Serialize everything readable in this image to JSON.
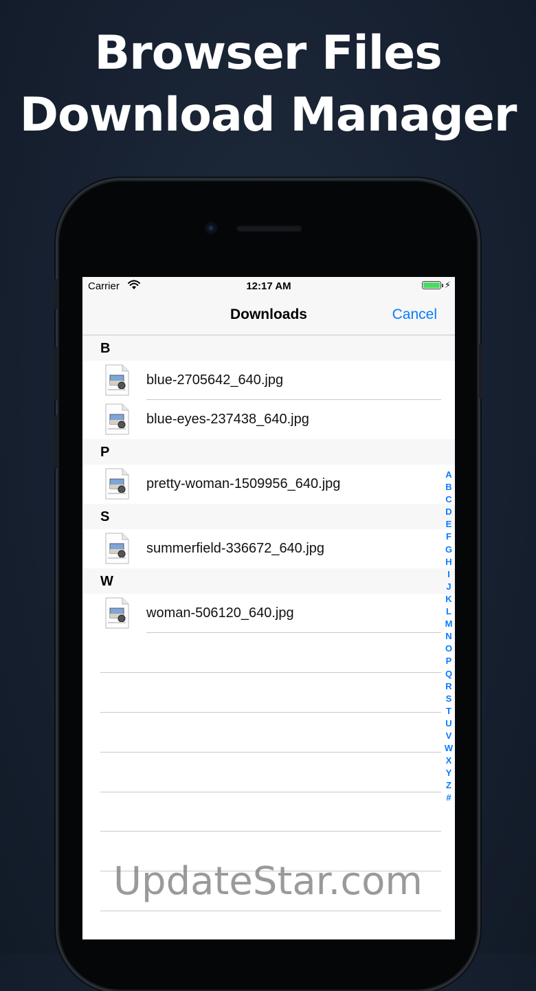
{
  "headline": {
    "line1": "Browser Files",
    "line2": "Download Manager"
  },
  "statusbar": {
    "carrier": "Carrier",
    "time": "12:17 AM",
    "bolt": "⚡",
    "battery_level": 1.0
  },
  "navbar": {
    "title": "Downloads",
    "cancel_label": "Cancel"
  },
  "sections": [
    {
      "letter": "B",
      "files": [
        "blue-2705642_640.jpg",
        "blue-eyes-237438_640.jpg"
      ]
    },
    {
      "letter": "P",
      "files": [
        "pretty-woman-1509956_640.jpg"
      ]
    },
    {
      "letter": "S",
      "files": [
        "summerfield-336672_640.jpg"
      ]
    },
    {
      "letter": "W",
      "files": [
        "woman-506120_640.jpg"
      ]
    }
  ],
  "index_letters": [
    "A",
    "B",
    "C",
    "D",
    "E",
    "F",
    "G",
    "H",
    "I",
    "J",
    "K",
    "L",
    "M",
    "N",
    "O",
    "P",
    "Q",
    "R",
    "S",
    "T",
    "U",
    "V",
    "W",
    "X",
    "Y",
    "Z",
    "#"
  ],
  "watermark": "UpdateStar.com",
  "colors": {
    "accent": "#0a7aff",
    "battery": "#4cd964",
    "background": "#172131"
  }
}
